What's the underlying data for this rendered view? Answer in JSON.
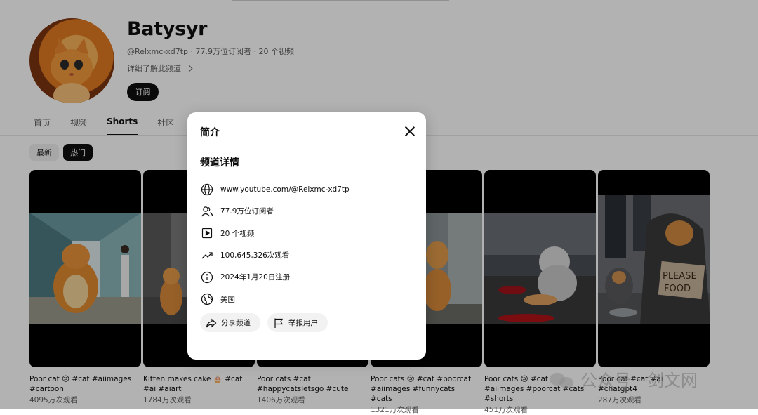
{
  "channel": {
    "name": "Batysyr",
    "meta": "@Relxmc-xd7tp · 77.9万位订阅者 · 20 个视频",
    "more_label": "详细了解此频道",
    "subscribe_label": "订阅"
  },
  "tabs": [
    {
      "label": "首页",
      "active": false
    },
    {
      "label": "视频",
      "active": false
    },
    {
      "label": "Shorts",
      "active": true
    },
    {
      "label": "社区",
      "active": false
    }
  ],
  "chips": {
    "latest": "最新",
    "hot": "热门"
  },
  "shorts": [
    {
      "title": "Poor cat 😢 #cat #aiimages #cartoon",
      "views": "4095万次观看"
    },
    {
      "title": "Kitten makes cake 🎂 #cat #ai #aiart",
      "views": "1784万次观看"
    },
    {
      "title": "Poor cats #cat #happycatsletsgo #cute",
      "views": "1406万次观看"
    },
    {
      "title": "Poor cats 😢 #cat #poorcat #aiimages #funnycats #cats",
      "views": "1321万次观看"
    },
    {
      "title": "Poor cats 😢 #cat #aiimages #poorcat #cats #shorts",
      "views": "451万次观看"
    },
    {
      "title": "Poor cat #cat #ai #chatgpt4",
      "views": "287万次观看"
    }
  ],
  "modal": {
    "title": "简介",
    "section_title": "频道详情",
    "rows": [
      {
        "icon": "globe-icon",
        "text": "www.youtube.com/@Relxmc-xd7tp"
      },
      {
        "icon": "subscribers-icon",
        "text": "77.9万位订阅者"
      },
      {
        "icon": "video-icon",
        "text": "20 个视频"
      },
      {
        "icon": "trending-icon",
        "text": "100,645,326次观看"
      },
      {
        "icon": "info-icon",
        "text": "2024年1月20日注册"
      },
      {
        "icon": "location-icon",
        "text": "美国"
      }
    ],
    "share_label": "分享频道",
    "report_label": "举报用户"
  },
  "watermark": {
    "text": "公众号 · 剑文网"
  }
}
